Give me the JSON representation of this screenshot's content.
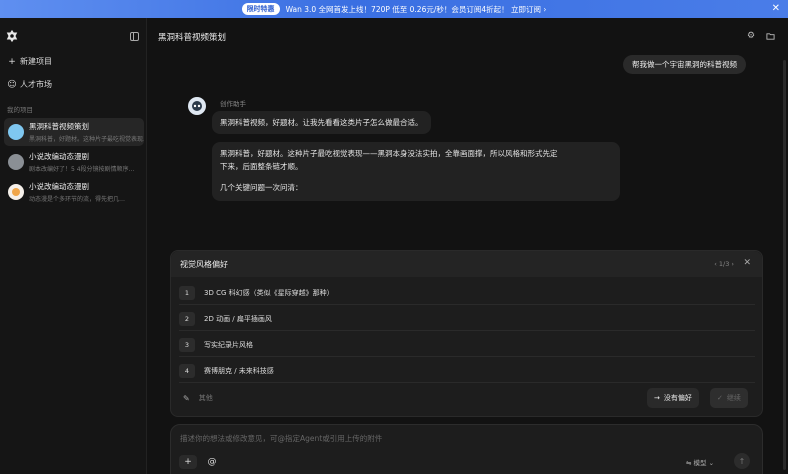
{
  "banner": {
    "tag": "限时特惠",
    "text": "Wan 3.0 全网首发上线！720P 低至 0.26元/秒！会员订阅4折起！ 立即订阅 ›",
    "close": "✕"
  },
  "sidebar": {
    "new_project": "新建项目",
    "talent_market": "人才市场",
    "my_projects_label": "我的项目",
    "projects": [
      {
        "title": "黑洞科普视频策划",
        "subtitle": "黑洞科普，好题材。这种片子最吃视觉表现…",
        "thumb_color": "#7fc7f0",
        "active": true
      },
      {
        "title": "小说改编动态漫剧",
        "subtitle": "剧本改编好了！5 4段分镜按剧情顺序…",
        "thumb_color": "#8a8f95",
        "active": false
      },
      {
        "title": "小说改编动态漫剧",
        "subtitle": "动态漫是个多环节的流，得先把几…",
        "thumb_color": "#f0a64a",
        "active": false
      }
    ]
  },
  "header": {
    "title": "黑洞科普视频策划"
  },
  "chat": {
    "user_message": "帮我做一个宇宙黑洞的科普视频",
    "bot_name": "创作助手",
    "bot_msg_1": "黑洞科普视频，好题材。让我先看看这类片子怎么做最合适。",
    "bot_msg_2_line1": "黑洞科普，好题材。这种片子最吃视觉表现——黑洞本身没法实拍，全靠画面撑，所以风格和形式先定",
    "bot_msg_2_line2": "下来，后面整条链才顺。",
    "bot_msg_2_line3": "几个关键问题一次问清："
  },
  "question": {
    "title": "视觉风格偏好",
    "pager": "‹ 1/3 ›",
    "options": [
      {
        "num": "1",
        "label": "3D CG 科幻感（类似《星际穿越》那种）"
      },
      {
        "num": "2",
        "label": "2D 动画 / 扁平插画风"
      },
      {
        "num": "3",
        "label": "写实纪录片风格"
      },
      {
        "num": "4",
        "label": "赛博朋克 / 未来科技感"
      }
    ],
    "other_label": "其他",
    "no_pref_label": "没有偏好",
    "continue_label": "继续"
  },
  "input": {
    "placeholder": "描述你的想法或修改意见，可@指定Agent或引用上传的附件",
    "model_label": "模型"
  }
}
